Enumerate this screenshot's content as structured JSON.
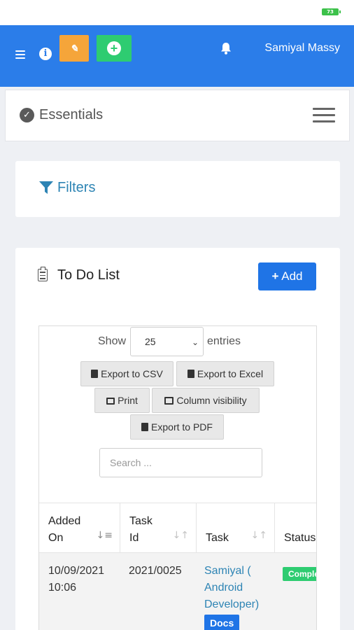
{
  "statusbar": {
    "battery": "73"
  },
  "topbar": {
    "orange_button_label": "✎",
    "user_name": "Samiyal Massy"
  },
  "essentials": {
    "title": "Essentials"
  },
  "filters": {
    "title": "Filters"
  },
  "todo": {
    "title": "To Do List",
    "add_label": "Add",
    "show_label": "Show",
    "entries_value": "25",
    "entries_label": "entries",
    "buttons": {
      "csv": "Export to CSV",
      "excel": "Export to Excel",
      "print": "Print",
      "columns": "Column visibility",
      "pdf": "Export to PDF"
    },
    "search_placeholder": "Search ...",
    "columns": [
      "Added On",
      "Task Id",
      "Task",
      "Status"
    ],
    "rows": [
      {
        "added_on": "10/09/2021 10:06",
        "task_id": "2021/0025",
        "task": "Samiyal ( Android Developer)",
        "tag": "Docs",
        "status": "Completed"
      }
    ]
  },
  "colors": {
    "topbar": "#2b7de9",
    "orange": "#f5a53a",
    "green": "#2ecc71",
    "link": "#2d84b4",
    "primary_button": "#1f74e6"
  }
}
